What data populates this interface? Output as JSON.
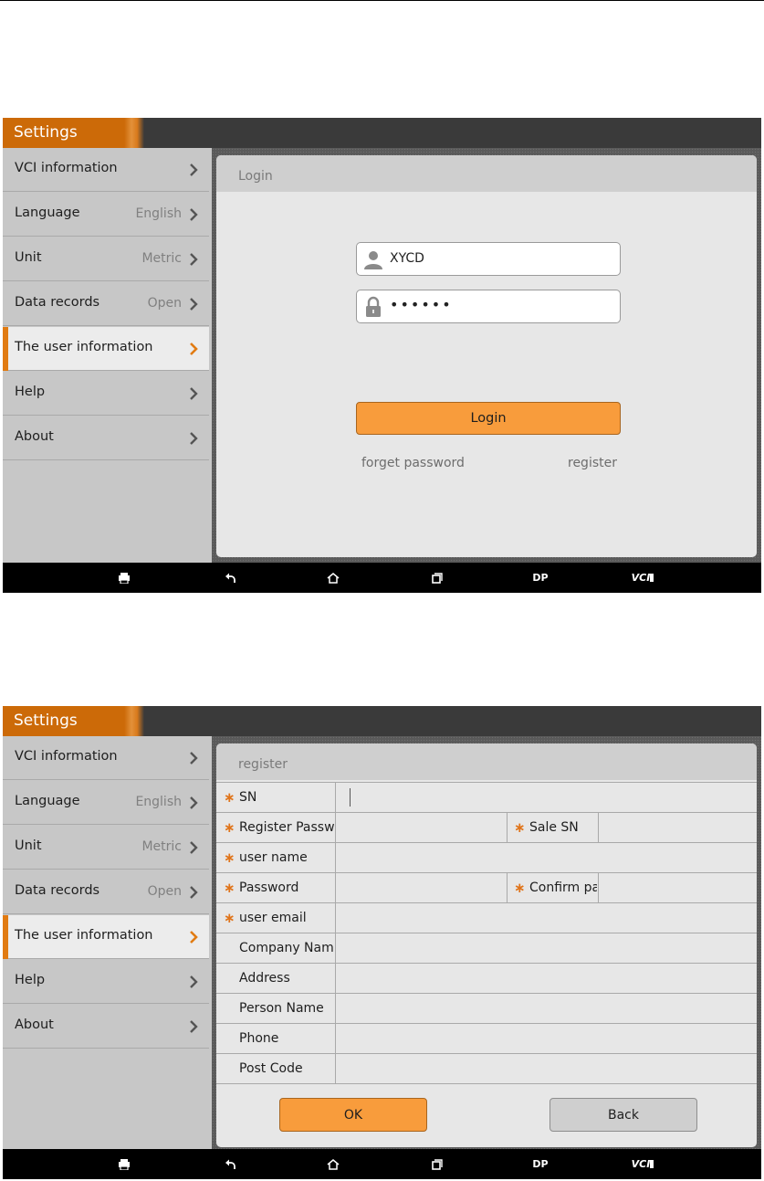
{
  "settings_title": "Settings",
  "sidebar": {
    "items": [
      {
        "label": "VCI information",
        "value": ""
      },
      {
        "label": "Language",
        "value": "English"
      },
      {
        "label": "Unit",
        "value": "Metric"
      },
      {
        "label": "Data records",
        "value": "Open"
      },
      {
        "label": "The user information",
        "value": ""
      },
      {
        "label": "Help",
        "value": ""
      },
      {
        "label": "About",
        "value": ""
      }
    ],
    "active_index": 4
  },
  "login": {
    "title": "Login",
    "username_value": "XYCD",
    "password_value": "••••••",
    "login_button": "Login",
    "forget_password": "forget password",
    "register_link": "register"
  },
  "register": {
    "title": "register",
    "fields": {
      "sn": "SN",
      "register_password": "Register Passw",
      "sale_sn": "Sale SN",
      "user_name": "user name",
      "password": "Password",
      "confirm_password": "Confirm pa",
      "user_email": "user email",
      "company_name": "Company Nam",
      "address": "Address",
      "person_name": "Person Name",
      "phone": "Phone",
      "post_code": "Post Code"
    },
    "ok_button": "OK",
    "back_button": "Back"
  },
  "navbar": {
    "dp": "DP",
    "vci": "VCI"
  },
  "colors": {
    "accent_orange": "#f89c3c",
    "title_orange": "#cc6a08",
    "required_star": "#e0741a"
  }
}
